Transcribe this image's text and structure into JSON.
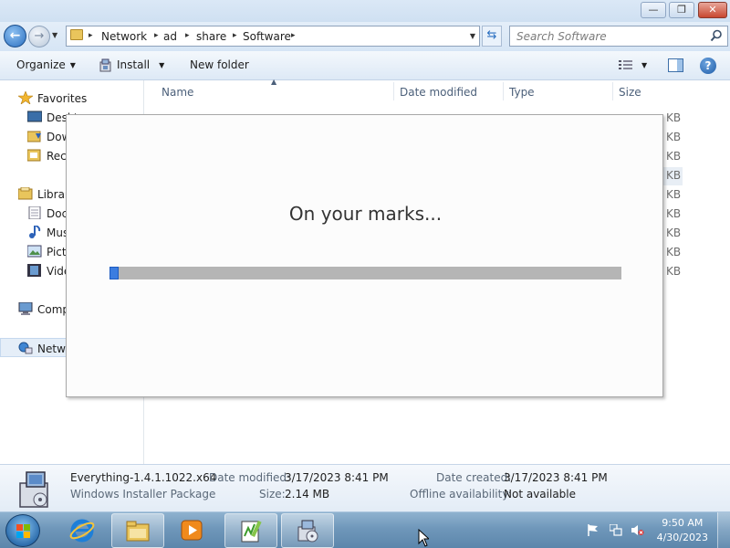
{
  "window": {
    "min_label": "—",
    "max_label": "❐",
    "close_label": "✕"
  },
  "nav": {
    "back_glyph": "←",
    "forward_glyph": "→",
    "breadcrumbs": [
      "Network",
      "ad",
      "share",
      "Software"
    ],
    "search_placeholder": "Search Software"
  },
  "toolbar": {
    "organize": "Organize",
    "install": "Install",
    "new_folder": "New folder",
    "help": "?"
  },
  "navpane": {
    "items": [
      {
        "label": "Favorites",
        "icon": "star-icon"
      },
      {
        "label": "Desktop",
        "icon": "desktop-icon"
      },
      {
        "label": "Downloads",
        "icon": "downloads-icon"
      },
      {
        "label": "Recent Places",
        "icon": "recent-places-icon"
      },
      {
        "label": "Libraries",
        "icon": "libraries-icon"
      },
      {
        "label": "Documents",
        "icon": "documents-icon"
      },
      {
        "label": "Music",
        "icon": "music-icon"
      },
      {
        "label": "Pictures",
        "icon": "pictures-icon"
      },
      {
        "label": "Videos",
        "icon": "videos-icon"
      },
      {
        "label": "Computer",
        "icon": "computer-icon"
      },
      {
        "label": "Network",
        "icon": "network-icon"
      }
    ]
  },
  "filelist": {
    "columns": [
      "Name",
      "Date modified",
      "Type",
      "Size"
    ],
    "size_units": [
      "KB",
      "KB",
      "KB",
      "KB",
      "KB",
      "KB",
      "KB",
      "KB",
      "KB"
    ]
  },
  "dialog": {
    "message": "On your marks...",
    "progress": 0.018
  },
  "details": {
    "file_name": "Everything-1.4.1.1022.x64",
    "file_type": "Windows Installer Package",
    "date_modified_label": "Date modified:",
    "date_modified": "3/17/2023 8:41 PM",
    "size_label": "Size:",
    "size": "2.14 MB",
    "date_created_label": "Date created:",
    "date_created": "3/17/2023 8:41 PM",
    "offline_label": "Offline availability:",
    "offline": "Not available"
  },
  "taskbar": {
    "time": "9:50 AM",
    "date": "4/30/2023",
    "apps": [
      "internet-explorer-icon",
      "file-explorer-icon",
      "media-player-icon",
      "notepad-plus-plus-icon",
      "installer-icon"
    ]
  }
}
